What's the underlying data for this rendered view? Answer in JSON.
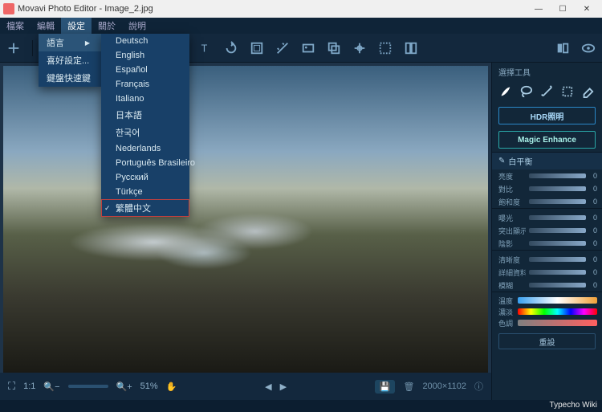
{
  "title": "Movavi Photo Editor - Image_2.jpg",
  "menubar": [
    "檔案",
    "編輯",
    "設定",
    "關於",
    "說明"
  ],
  "menubar_active_index": 2,
  "settings_menu": {
    "items": [
      {
        "label": "語言",
        "has_submenu": true,
        "hover": true
      },
      {
        "label": "喜好設定...",
        "has_submenu": false
      },
      {
        "label": "鍵盤快速鍵",
        "has_submenu": false
      }
    ]
  },
  "language_submenu": [
    "Deutsch",
    "English",
    "Español",
    "Français",
    "Italiano",
    "日本語",
    "한국어",
    "Nederlands",
    "Português Brasileiro",
    "Русский",
    "Türkçe",
    "繁體中文"
  ],
  "language_selected_index": 11,
  "language_highlight_index": 11,
  "toolbar_icons": [
    "plus-icon",
    "adjust-icon",
    "color-icon",
    "denoise-icon",
    "retouch-icon",
    "crop-icon",
    "resize-icon",
    "text-icon",
    "rotate-icon",
    "frame-icon",
    "effects-icon",
    "insert-icon",
    "overlay-icon",
    "transform-icon",
    "remove-bg-icon",
    "guides-icon"
  ],
  "toolbar_right": [
    "compare-icon",
    "preview-icon"
  ],
  "side": {
    "title": "選擇工具",
    "tool_icons": [
      "brush-icon",
      "lasso-icon",
      "wand-icon",
      "marquee-icon",
      "eraser-icon"
    ],
    "hdr_button": "HDR照明",
    "magic_button": "Magic Enhance",
    "wb_section": {
      "label": "白平衡",
      "dropper": true
    },
    "sliders1": [
      {
        "label": "亮度",
        "value": 0
      },
      {
        "label": "對比",
        "value": 0
      },
      {
        "label": "飽和度",
        "value": 0
      }
    ],
    "sliders2": [
      {
        "label": "曝光",
        "value": 0
      },
      {
        "label": "突出顯示",
        "value": 0
      },
      {
        "label": "陰影",
        "value": 0
      }
    ],
    "sliders3": [
      {
        "label": "清晰度",
        "value": 0
      },
      {
        "label": "詳細資料",
        "value": 0
      },
      {
        "label": "模糊",
        "value": 0
      }
    ],
    "gradients": [
      {
        "label": "溫度",
        "class": "temp"
      },
      {
        "label": "濃淡",
        "class": "hue"
      },
      {
        "label": "色調",
        "class": "sat"
      }
    ],
    "reset": "重設"
  },
  "bottom": {
    "zoom_reset": "1:1",
    "zoom_pct": "51%",
    "dimensions": "2000×1102",
    "tool_active": "pan-icon"
  },
  "watermark": "Typecho Wiki"
}
